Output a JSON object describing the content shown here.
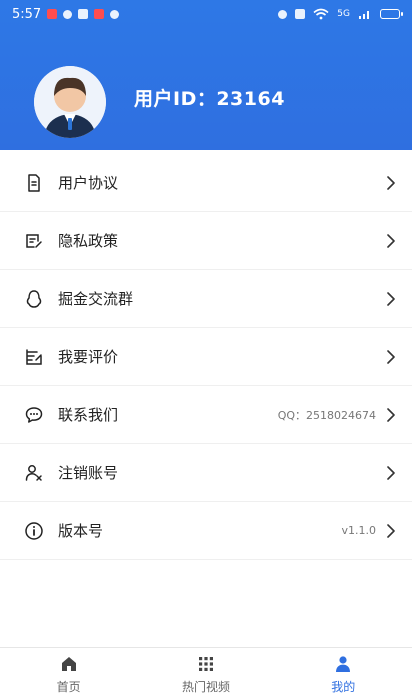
{
  "status_bar": {
    "time": "5:57",
    "net_label": "5G"
  },
  "profile": {
    "user_id_label": "用户ID：23164"
  },
  "menu_items": [
    {
      "label": "用户协议",
      "value": ""
    },
    {
      "label": "隐私政策",
      "value": ""
    },
    {
      "label": "掘金交流群",
      "value": ""
    },
    {
      "label": "我要评价",
      "value": ""
    },
    {
      "label": "联系我们",
      "value": "QQ：2518024674"
    },
    {
      "label": "注销账号",
      "value": ""
    },
    {
      "label": "版本号",
      "value": "v1.1.0"
    }
  ],
  "tabbar": {
    "tabs": [
      {
        "label": "首页",
        "active": false
      },
      {
        "label": "热门视频",
        "active": false
      },
      {
        "label": "我的",
        "active": true
      }
    ]
  },
  "colors": {
    "header": "#2f6fe0",
    "active": "#2f6fe0"
  }
}
